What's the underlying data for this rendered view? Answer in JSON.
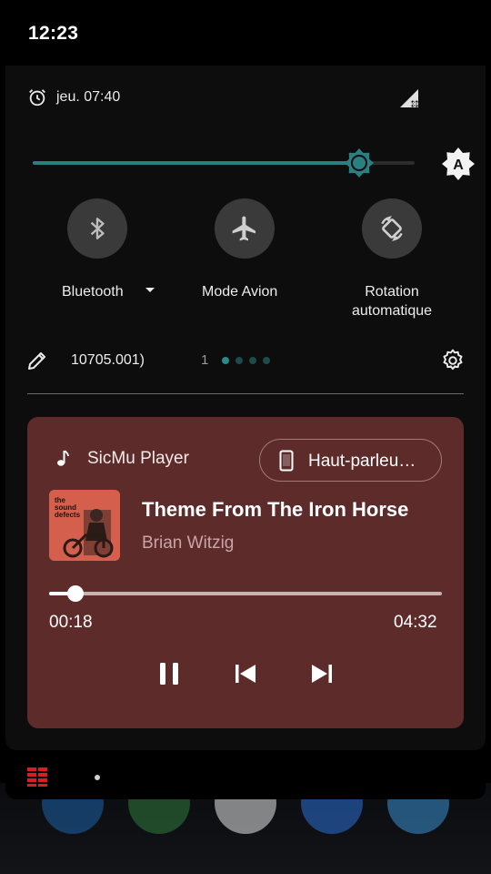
{
  "status_bar": {
    "time": "12:23"
  },
  "header": {
    "alarm": "jeu. 07:40"
  },
  "brightness": {
    "level": 0.86,
    "auto_label": "A"
  },
  "tiles": [
    {
      "label": "Bluetooth",
      "icon": "bluetooth-icon"
    },
    {
      "label": "Mode Avion",
      "icon": "airplane-icon"
    },
    {
      "label_line1": "Rotation",
      "label_line2": "automatique",
      "icon": "rotate-icon"
    }
  ],
  "footer": {
    "build": "10705.001)",
    "page": "1",
    "page_count": 4,
    "active_page": 1
  },
  "media": {
    "app": "SicMu Player",
    "output": "Haut-parleu…",
    "title": "Theme From The Iron Horse",
    "artist": "Brian Witzig",
    "current_time": "00:18",
    "total_time": "04:32",
    "progress": 0.066,
    "album_art_text": "the sound defects"
  },
  "colors": {
    "accent": "#2a7f80",
    "media_bg": "#5e2b2b",
    "shade_bg": "#0d0d0d"
  }
}
